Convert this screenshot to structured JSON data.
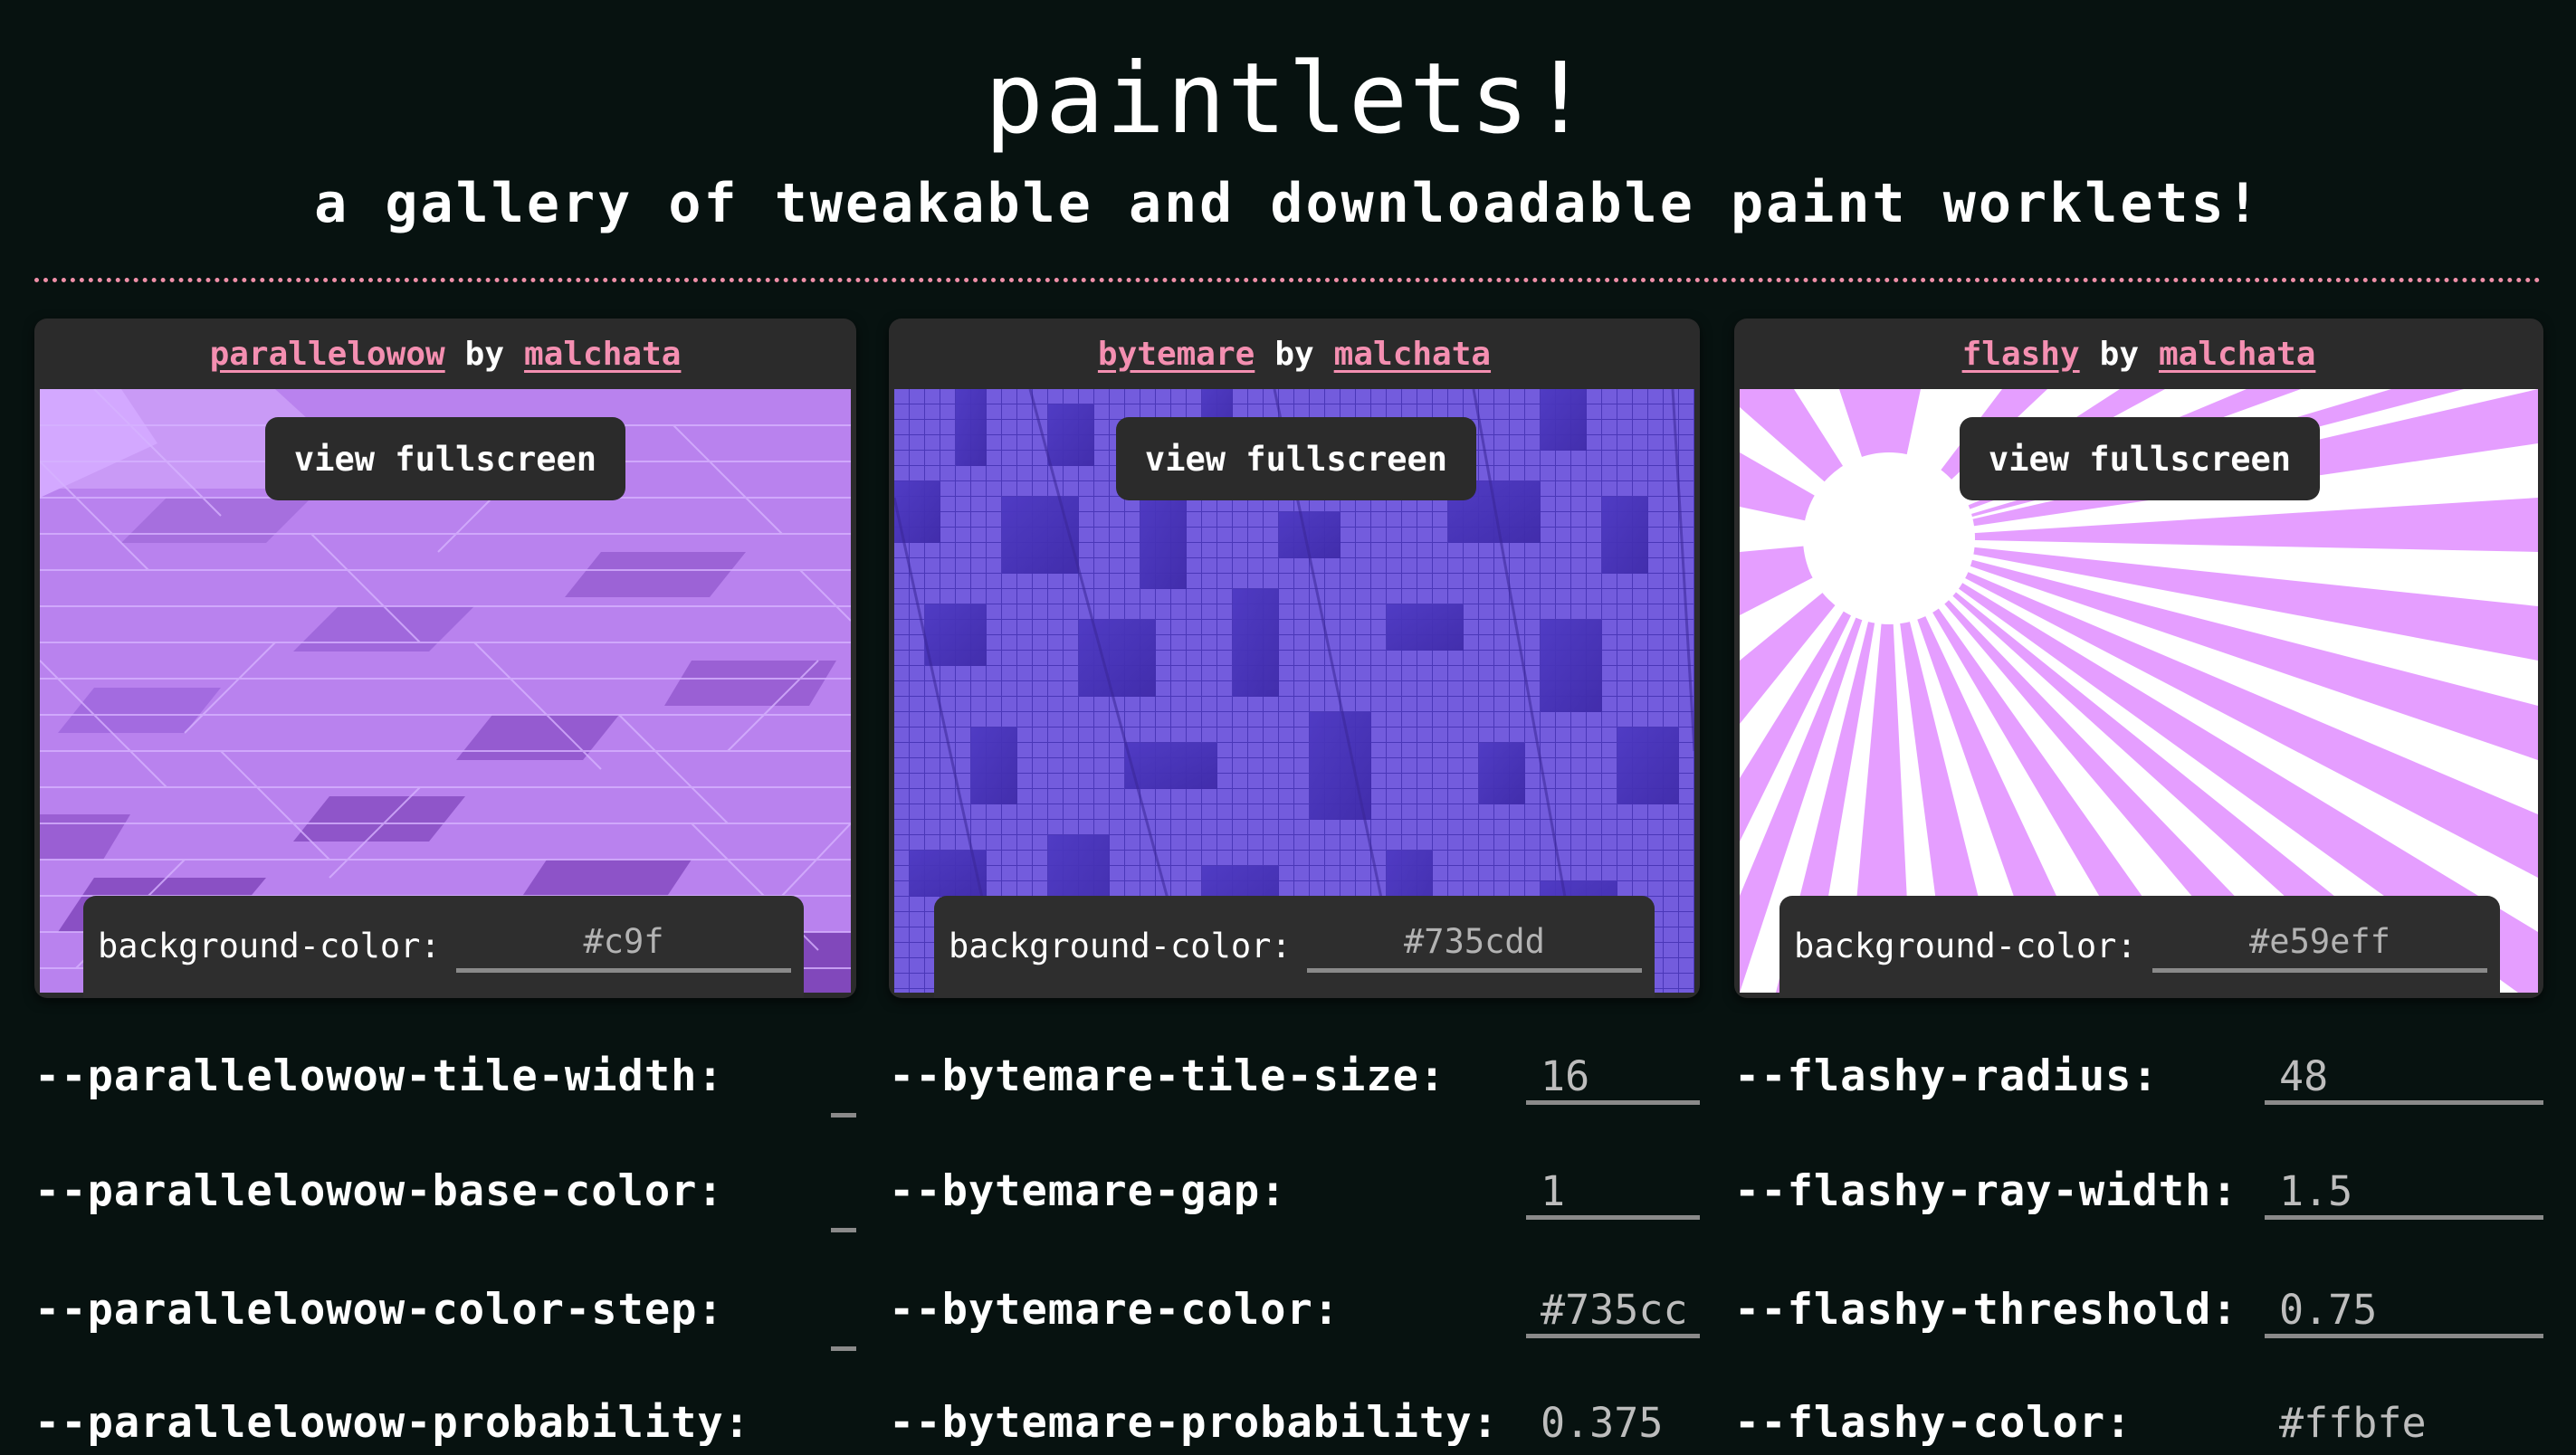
{
  "page": {
    "title": "paintlets!",
    "subtitle": "a gallery of tweakable and downloadable paint worklets!"
  },
  "cards": [
    {
      "name": "parallelowow",
      "by": "by",
      "author": "malchata",
      "fullscreen_label": "view fullscreen",
      "bg_label": "background-color:",
      "bg_value": "#c9f",
      "props": [
        {
          "label": "--parallelowow-tile-width:",
          "value": ""
        },
        {
          "label": "--parallelowow-base-color:",
          "value": ""
        },
        {
          "label": "--parallelowow-color-step:",
          "value": ""
        },
        {
          "label": "--parallelowow-probability:",
          "value": ""
        }
      ]
    },
    {
      "name": "bytemare",
      "by": "by",
      "author": "malchata",
      "fullscreen_label": "view fullscreen",
      "bg_label": "background-color:",
      "bg_value": "#735cdd",
      "props": [
        {
          "label": "--bytemare-tile-size:",
          "value": "16"
        },
        {
          "label": "--bytemare-gap:",
          "value": "1"
        },
        {
          "label": "--bytemare-color:",
          "value": "#735cc"
        },
        {
          "label": "--bytemare-probability:",
          "value": "0.375"
        }
      ]
    },
    {
      "name": "flashy",
      "by": "by",
      "author": "malchata",
      "fullscreen_label": "view fullscreen",
      "bg_label": "background-color:",
      "bg_value": "#e59eff",
      "props": [
        {
          "label": "--flashy-radius:",
          "value": "48"
        },
        {
          "label": "--flashy-ray-width:",
          "value": "1.5"
        },
        {
          "label": "--flashy-threshold:",
          "value": "0.75"
        },
        {
          "label": "--flashy-color:",
          "value": "#ffbfe"
        }
      ]
    }
  ],
  "colors": {
    "background": "#071210",
    "link": "#f48fb1",
    "divider": "#ef8fa8",
    "parallelowow_bg": "#cc99ff",
    "bytemare_bg": "#735cdd",
    "flashy_bg": "#e59eff"
  }
}
